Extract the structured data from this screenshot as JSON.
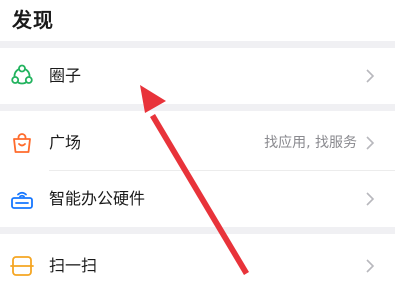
{
  "header": {
    "title": "发现"
  },
  "menu": {
    "items": [
      {
        "label": "圈子",
        "subtitle": "",
        "icon": "circle-network-icon"
      },
      {
        "label": "广场",
        "subtitle": "找应用, 找服务",
        "icon": "shopping-bag-icon"
      },
      {
        "label": "智能办公硬件",
        "subtitle": "",
        "icon": "device-wifi-icon"
      },
      {
        "label": "扫一扫",
        "subtitle": "",
        "icon": "scan-icon"
      }
    ]
  },
  "colors": {
    "accent_green": "#22b35e",
    "accent_orange": "#ff6b2c",
    "accent_blue": "#1677ff",
    "accent_amber": "#f5a623",
    "annotation_red": "#e8333a",
    "separator": "#f0f0f3"
  },
  "annotation": {
    "icon": "red-pointer-arrow",
    "target": "圈子"
  }
}
